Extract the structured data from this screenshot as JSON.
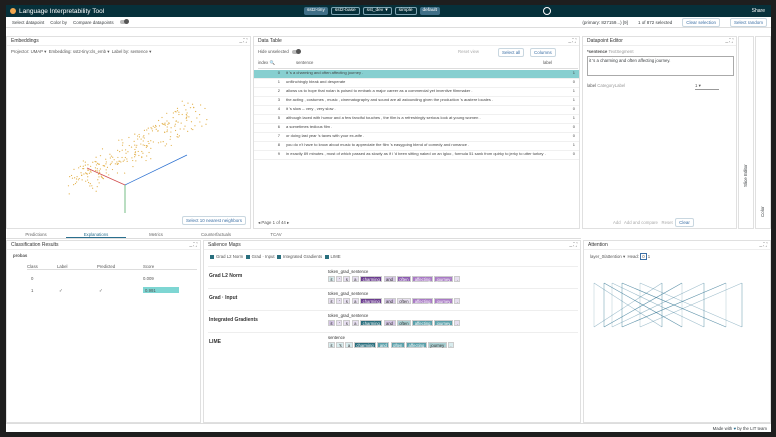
{
  "header": {
    "title": "Language Interpretability Tool",
    "models": [
      "sst2-tiny",
      "sst2-base"
    ],
    "dataset": "sst_dev",
    "layouts": [
      "simple",
      "default"
    ],
    "share": "Share"
  },
  "toolbar": {
    "select_datapoint": "Select datapoint",
    "color_by": "Color by",
    "compare": "Compare datapoints",
    "primary": "(primary: 827159...) [9]",
    "selected": "1 of 872 selected",
    "clear": "Clear selection",
    "random": "Select random"
  },
  "embeddings": {
    "title": "Embeddings",
    "projector_label": "Projector:",
    "projector": "UMAP",
    "embedding_label": "Embedding:",
    "embedding": "sst2-tiny:cls_emb",
    "label_by": "Label by:",
    "label_val": "sentence",
    "nearest": "Select 10 nearest neighbors"
  },
  "data_table": {
    "title": "Data Table",
    "hide_unselected": "Hide unselected",
    "reset_view": "Reset view",
    "select_all": "Select all",
    "columns": "Columns",
    "col_index": "index",
    "col_sentence": "sentence",
    "col_label": "label",
    "rows": [
      {
        "i": "0",
        "s": "it 's a charming and often affecting journey .",
        "l": "1"
      },
      {
        "i": "1",
        "s": "unflinchingly bleak and desperate",
        "l": "0"
      },
      {
        "i": "2",
        "s": "allows us to hope that nolan is poised to embark a major career as a commercial yet inventive filmmaker .",
        "l": "1"
      },
      {
        "i": "3",
        "s": "the acting , costumes , music , cinematography and sound are all astounding given the production 's austere locales .",
        "l": "1"
      },
      {
        "i": "4",
        "s": "it 's slow -- very , very slow .",
        "l": "0"
      },
      {
        "i": "5",
        "s": "although laced with humor and a few fanciful touches , the film is a refreshingly serious look at young women .",
        "l": "1"
      },
      {
        "i": "6",
        "s": "a sometimes tedious film .",
        "l": "0"
      },
      {
        "i": "7",
        "s": "or doing last year 's taxes with your ex-wife .",
        "l": "0"
      },
      {
        "i": "8",
        "s": "you do n't have to know about music to appreciate the film 's easygoing blend of comedy and romance .",
        "l": "1"
      },
      {
        "i": "9",
        "s": "in exactly 89 minutes , most of which passed as slowly as if i 'd been sitting naked on an igloo , formula 51 sank from quirky to jerky to utter turkey .",
        "l": "0"
      }
    ],
    "page": "Page",
    "page_num": "1",
    "page_of": "of 44"
  },
  "editor": {
    "title": "Datapoint Editor",
    "field": "*sentence",
    "field_type": "TextSegment",
    "value": "it 's a charming and often affecting journey.",
    "label": "label",
    "label_type": "CategoryLabel",
    "label_val": "1",
    "add": "Add",
    "add_compare": "Add and compare",
    "reset": "Reset",
    "clear": "Clear"
  },
  "side_tabs": [
    "Slice Editor",
    "Color"
  ],
  "tabs": [
    "Predictions",
    "Explanations",
    "Metrics",
    "Counterfactuals",
    "TCAV"
  ],
  "classification": {
    "title": "Classification Results",
    "head": "probas",
    "cols": [
      "Class",
      "Label",
      "Predicted",
      "Score"
    ],
    "rows": [
      {
        "c": "0",
        "l": "",
        "p": "",
        "s": "0.009"
      },
      {
        "c": "1",
        "l": "✓",
        "p": "✓",
        "s": "0.991"
      }
    ],
    "score_pct": 0.991
  },
  "salience": {
    "title": "Salience Maps",
    "methods": [
      "Grad L2 Norm",
      "Grad · Input",
      "Integrated Gradients",
      "LIME"
    ],
    "rows": [
      {
        "name": "Grad L2 Norm",
        "field": "token_grad_sentence",
        "tokens": [
          "it",
          "'",
          "s",
          "a",
          "charming",
          "and",
          "often",
          "affecting",
          "journey",
          "."
        ]
      },
      {
        "name": "Grad · Input",
        "field": "token_grad_sentence",
        "tokens": [
          "it",
          "'",
          "s",
          "a",
          "charming",
          "and",
          "often",
          "affecting",
          "journey",
          "."
        ]
      },
      {
        "name": "Integrated Gradients",
        "field": "token_grad_sentence",
        "tokens": [
          "it",
          "'",
          "s",
          "a",
          "charming",
          "and",
          "often",
          "affecting",
          "journey",
          "."
        ]
      },
      {
        "name": "LIME",
        "field": "sentence",
        "tokens": [
          "it",
          "'s",
          "a",
          "charming",
          "and",
          "often",
          "affecting",
          "journey",
          "."
        ]
      }
    ]
  },
  "attention": {
    "title": "Attention",
    "layer": "layer_0/attention",
    "head_label": "Head:",
    "head": "0",
    "head2": "1"
  },
  "footer": {
    "made": "Made with",
    "by": "by the LIT team"
  }
}
